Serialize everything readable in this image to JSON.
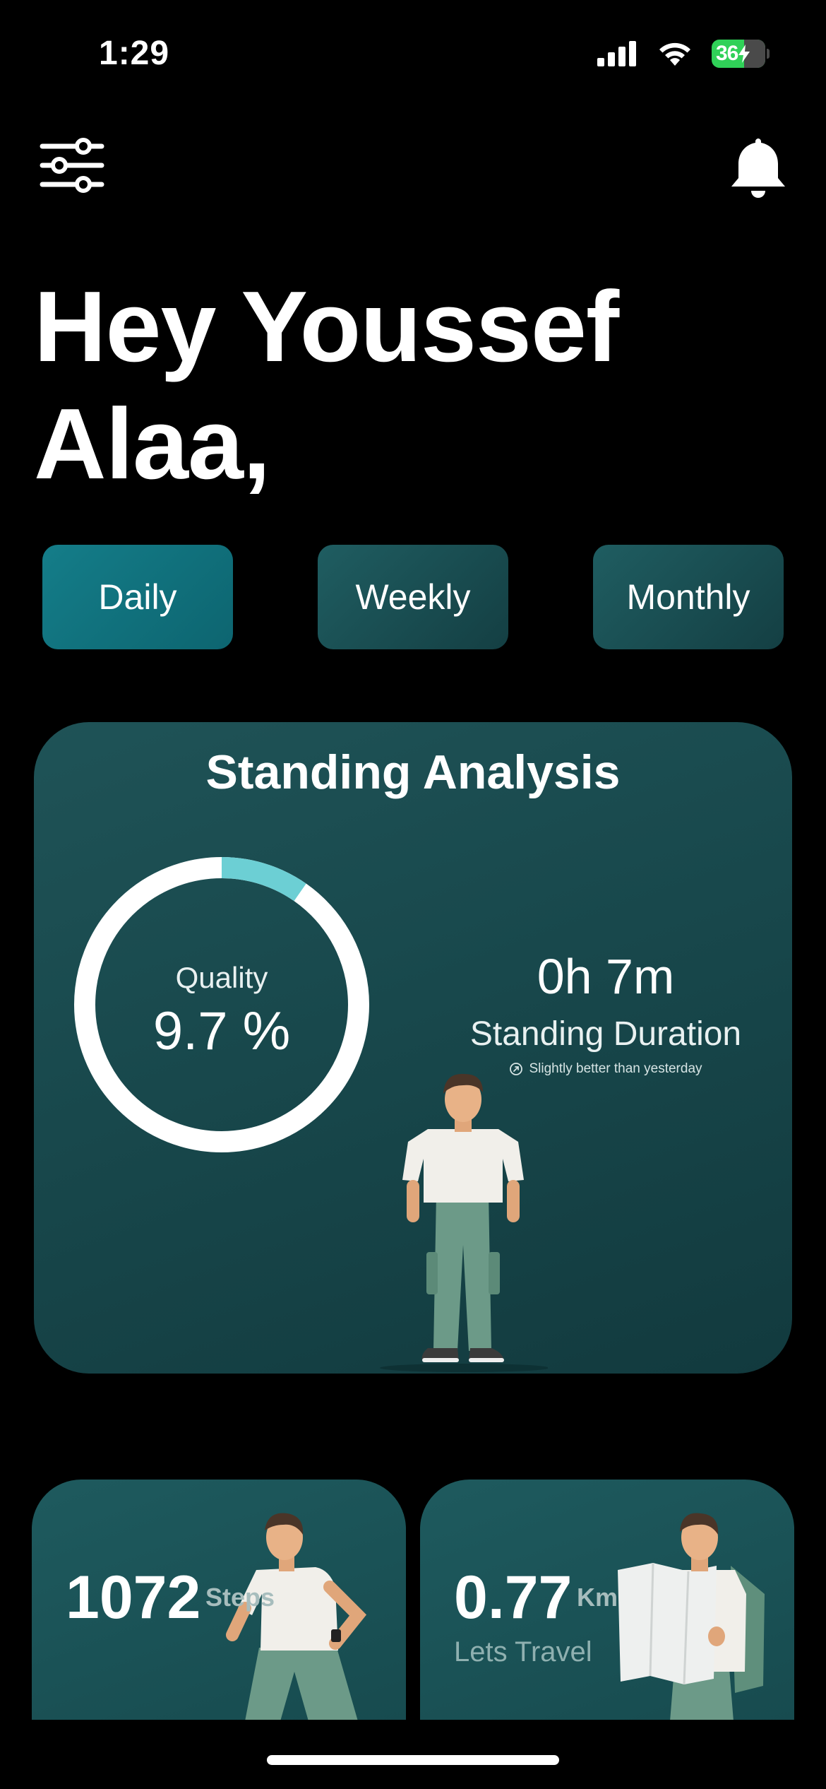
{
  "status_bar": {
    "time": "1:29",
    "battery": "36"
  },
  "header": {
    "menu_icon": "sliders-icon",
    "notification_icon": "bell-icon"
  },
  "greeting": "Hey Youssef Alaa,",
  "tabs": [
    {
      "label": "Daily",
      "active": true
    },
    {
      "label": "Weekly",
      "active": false
    },
    {
      "label": "Monthly",
      "active": false
    }
  ],
  "standing_card": {
    "title": "Standing Analysis",
    "quality_label": "Quality",
    "quality_value": "9.7 %",
    "quality_fraction": 0.097,
    "duration_value": "0h 7m",
    "duration_label": "Standing Duration",
    "comparison": "Slightly better than yesterday"
  },
  "steps_card": {
    "value": "1072",
    "unit": "Steps"
  },
  "distance_card": {
    "value": "0.77",
    "unit": "Km",
    "subtitle": "Lets Travel"
  },
  "colors": {
    "background": "#000000",
    "card": "#1a4c50",
    "active_tab": "#117785",
    "ring_track": "#ffffff",
    "ring_progress": "#6ccfd4",
    "battery": "#30d158"
  }
}
